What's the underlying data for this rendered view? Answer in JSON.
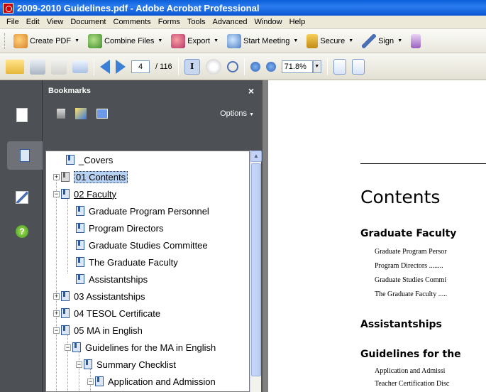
{
  "window": {
    "title": "2009-2010 Guidelines.pdf - Adobe Acrobat Professional"
  },
  "menu": [
    "File",
    "Edit",
    "View",
    "Document",
    "Comments",
    "Forms",
    "Tools",
    "Advanced",
    "Window",
    "Help"
  ],
  "toolbar_tasks": {
    "create_pdf": "Create PDF",
    "combine_files": "Combine Files",
    "export": "Export",
    "start_meeting": "Start Meeting",
    "secure": "Secure",
    "sign": "Sign"
  },
  "navigation": {
    "current_page": "4",
    "total_pages": "/ 116",
    "zoom": "71.8%"
  },
  "bookmarks_panel": {
    "title": "Bookmarks",
    "close": "×",
    "options_label": "Options",
    "items": [
      {
        "label": "_Covers"
      },
      {
        "label": "01 Contents",
        "expander": "+"
      },
      {
        "label": "02 Faculty",
        "expander": "−"
      },
      {
        "label": "Graduate Program Personnel"
      },
      {
        "label": "Program Directors"
      },
      {
        "label": "Graduate Studies Committee"
      },
      {
        "label": "The Graduate Faculty"
      },
      {
        "label": "Assistantships"
      },
      {
        "label": "03 Assistantships",
        "expander": "+"
      },
      {
        "label": "04 TESOL Certificate",
        "expander": "+"
      },
      {
        "label": "05 MA in English",
        "expander": "−"
      },
      {
        "label": "Guidelines for the MA in English",
        "expander": "−"
      },
      {
        "label": "Summary Checklist",
        "expander": "−"
      },
      {
        "label": "Application and Admission",
        "expander": "−"
      }
    ]
  },
  "document": {
    "heading": "Contents",
    "sections": [
      {
        "title": "Graduate Faculty"
      },
      {
        "title": "Assistantships"
      },
      {
        "title": "Guidelines for the"
      }
    ],
    "entries": [
      "Graduate Program Persor",
      "Program Directors ........",
      "Graduate Studies Commi",
      "The Graduate Faculty .....",
      "Application and Admissi",
      "Teacher Certification Disc"
    ]
  }
}
